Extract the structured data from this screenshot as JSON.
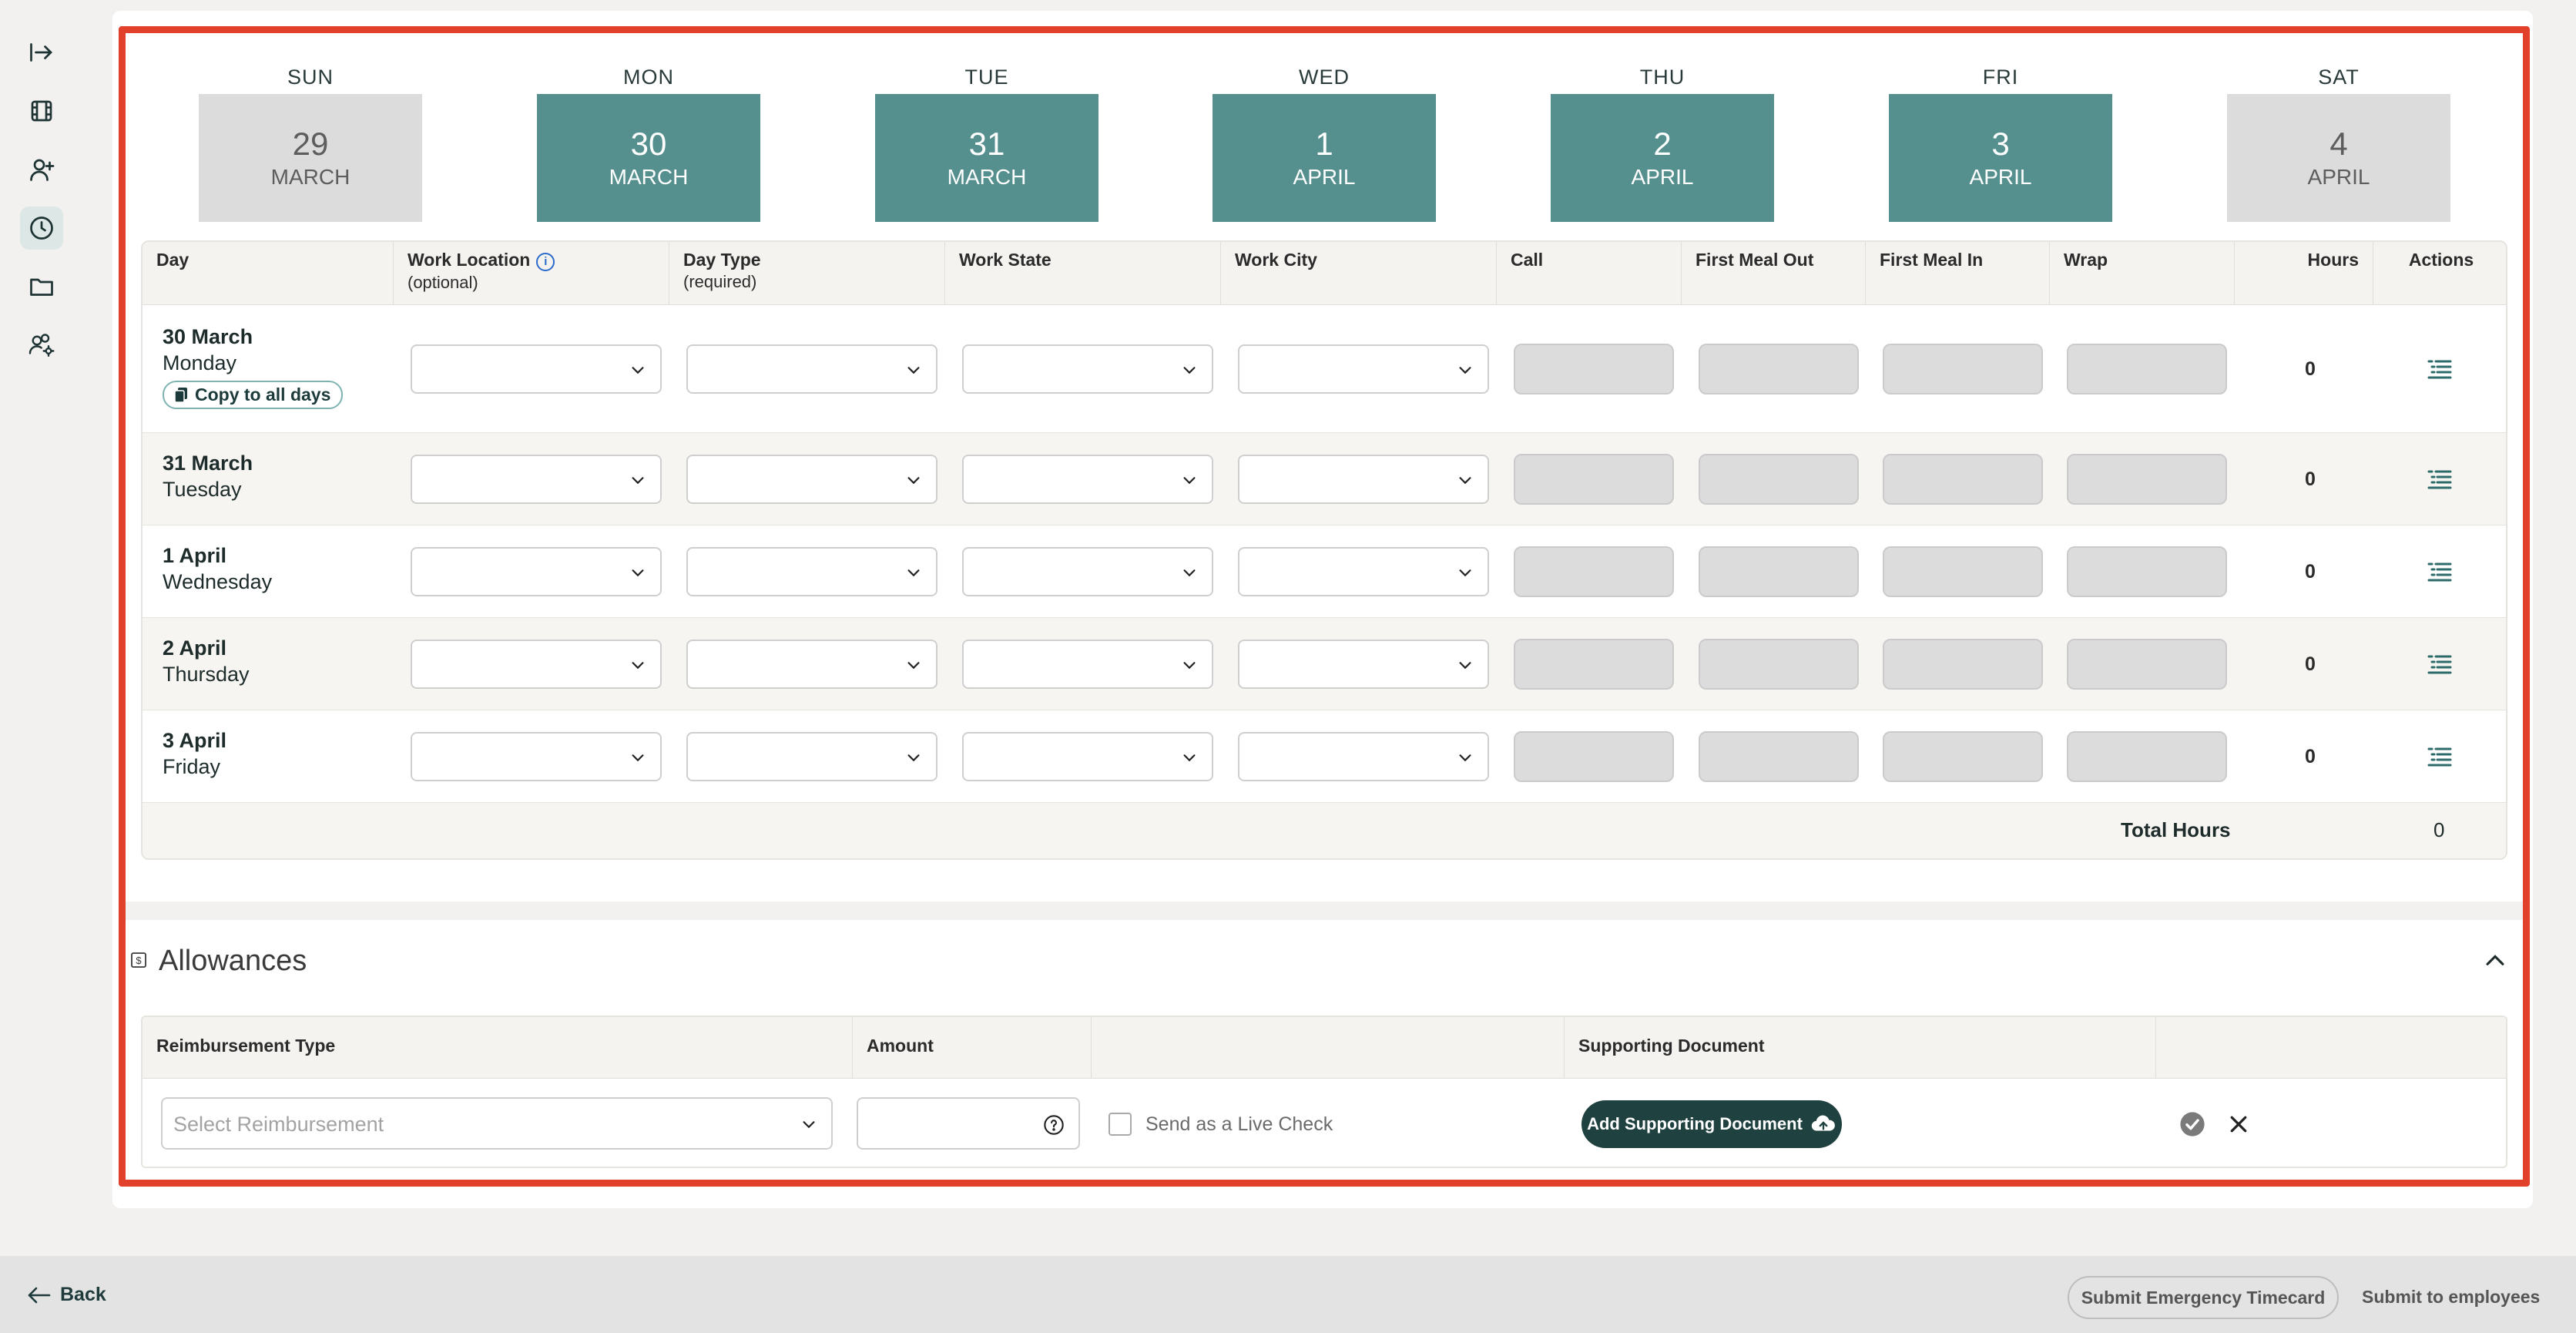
{
  "week": [
    {
      "dow": "SUN",
      "num": "29",
      "month": "MARCH",
      "work": false
    },
    {
      "dow": "MON",
      "num": "30",
      "month": "MARCH",
      "work": true
    },
    {
      "dow": "TUE",
      "num": "31",
      "month": "MARCH",
      "work": true
    },
    {
      "dow": "WED",
      "num": "1",
      "month": "APRIL",
      "work": true
    },
    {
      "dow": "THU",
      "num": "2",
      "month": "APRIL",
      "work": true
    },
    {
      "dow": "FRI",
      "num": "3",
      "month": "APRIL",
      "work": true
    },
    {
      "dow": "SAT",
      "num": "4",
      "month": "APRIL",
      "work": false
    }
  ],
  "table": {
    "headers": {
      "day": "Day",
      "work_location": "Work Location",
      "work_location_sub": "(optional)",
      "day_type": "Day Type",
      "day_type_sub": "(required)",
      "work_state": "Work State",
      "work_city": "Work City",
      "call": "Call",
      "first_meal_out": "First Meal Out",
      "first_meal_in": "First Meal In",
      "wrap": "Wrap",
      "hours": "Hours",
      "actions": "Actions"
    },
    "rows": [
      {
        "date": "30 March",
        "weekday": "Monday",
        "hours": "0"
      },
      {
        "date": "31 March",
        "weekday": "Tuesday",
        "hours": "0"
      },
      {
        "date": "1 April",
        "weekday": "Wednesday",
        "hours": "0"
      },
      {
        "date": "2 April",
        "weekday": "Thursday",
        "hours": "0"
      },
      {
        "date": "3 April",
        "weekday": "Friday",
        "hours": "0"
      }
    ],
    "copy_label": "Copy to all days",
    "total_label": "Total Hours",
    "total_value": "0"
  },
  "allowances": {
    "title": "Allowances",
    "headers": {
      "reimbursement_type": "Reimbursement Type",
      "amount": "Amount",
      "supporting_document": "Supporting Document"
    },
    "reimbursement_placeholder": "Select Reimbursement",
    "live_check_label": "Send as a Live Check",
    "add_document_label": "Add Supporting Document"
  },
  "footer": {
    "back_label": "Back",
    "emergency_label": "Submit Emergency Timecard",
    "submit_label": "Submit to employees"
  },
  "colors": {
    "accent": "#55908f",
    "dark": "#1f4140",
    "highlight_frame": "#e1402a"
  }
}
